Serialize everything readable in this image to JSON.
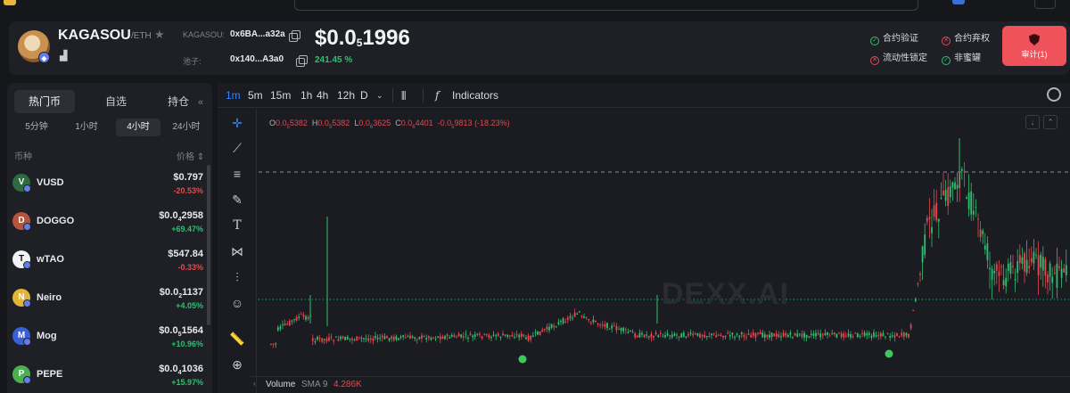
{
  "header": {
    "token_name": "KAGASOU",
    "chain": "/ETH",
    "contract_label": "KAGASOU:",
    "contract_value": "0x6BA...a32a",
    "pool_label": "池子:",
    "pool_value": "0x140...A3a0",
    "price_prefix": "$0.0",
    "price_sub": "5",
    "price_rest": "1996",
    "change_pct": "241.45 %",
    "checks": [
      {
        "label": "合约验证",
        "status": "ok"
      },
      {
        "label": "合约弃权",
        "status": "bad"
      },
      {
        "label": "流动性锁定",
        "status": "bad"
      },
      {
        "label": "非蜜罐",
        "status": "ok"
      }
    ],
    "audit_label": "审计(1)"
  },
  "sidebar": {
    "tabs": [
      "热门币",
      "自选",
      "持仓"
    ],
    "active_tab": 0,
    "timeframes": [
      "5分钟",
      "1小时",
      "4小时",
      "24小时"
    ],
    "active_timeframe": 2,
    "col_coin": "币种",
    "col_price": "价格 ⇕",
    "coins": [
      {
        "symbol": "VUSD",
        "price": "$0.797",
        "change": "-20.53%",
        "dir": "down",
        "icon_color": "#2e6b3f",
        "icon_char": "V"
      },
      {
        "symbol": "DOGGO",
        "price_a": "$0.0",
        "price_sub": "4",
        "price_b": "2958",
        "change": "+69.47%",
        "dir": "up",
        "icon_color": "#b3553c",
        "icon_char": "D"
      },
      {
        "symbol": "wTAO",
        "price": "$547.84",
        "change": "-0.33%",
        "dir": "down",
        "icon_color": "#f2f3f5",
        "icon_char": "T"
      },
      {
        "symbol": "Neiro",
        "price_a": "$0.0",
        "price_sub": "2",
        "price_b": "1137",
        "change": "+4.05%",
        "dir": "up",
        "icon_color": "#e4b43a",
        "icon_char": "N"
      },
      {
        "symbol": "Mog",
        "price_a": "$0.0",
        "price_sub": "5",
        "price_b": "1564",
        "change": "+10.96%",
        "dir": "up",
        "icon_color": "#3b5fd6",
        "icon_char": "M"
      },
      {
        "symbol": "PEPE",
        "price_a": "$0.0",
        "price_sub": "4",
        "price_b": "1036",
        "change": "+15.97%",
        "dir": "up",
        "icon_color": "#4caf50",
        "icon_char": "P"
      }
    ]
  },
  "chart": {
    "intervals": [
      "1m",
      "5m",
      "15m",
      "1h",
      "4h",
      "12h",
      "D"
    ],
    "active_interval": "1m",
    "indicators_label": "Indicators",
    "ohlc": {
      "o_label": "O",
      "o_a": "0.0",
      "o_sub": "5",
      "o_b": "5382",
      "h_label": "H",
      "h_a": "0.0",
      "h_sub": "5",
      "h_b": "5382",
      "l_label": "L",
      "l_a": "0.0",
      "l_sub": "6",
      "l_b": "3625",
      "c_label": "C",
      "c_a": "0.0",
      "c_sub": "6",
      "c_b": "4401",
      "delta_a": "-0.0",
      "delta_sub": "5",
      "delta_b": "9813",
      "pct": "(-18.23%)"
    },
    "watermark": "DEXX.AI",
    "volume_label": "Volume",
    "volume_sma": "SMA 9",
    "volume_value": "4.286K"
  }
}
